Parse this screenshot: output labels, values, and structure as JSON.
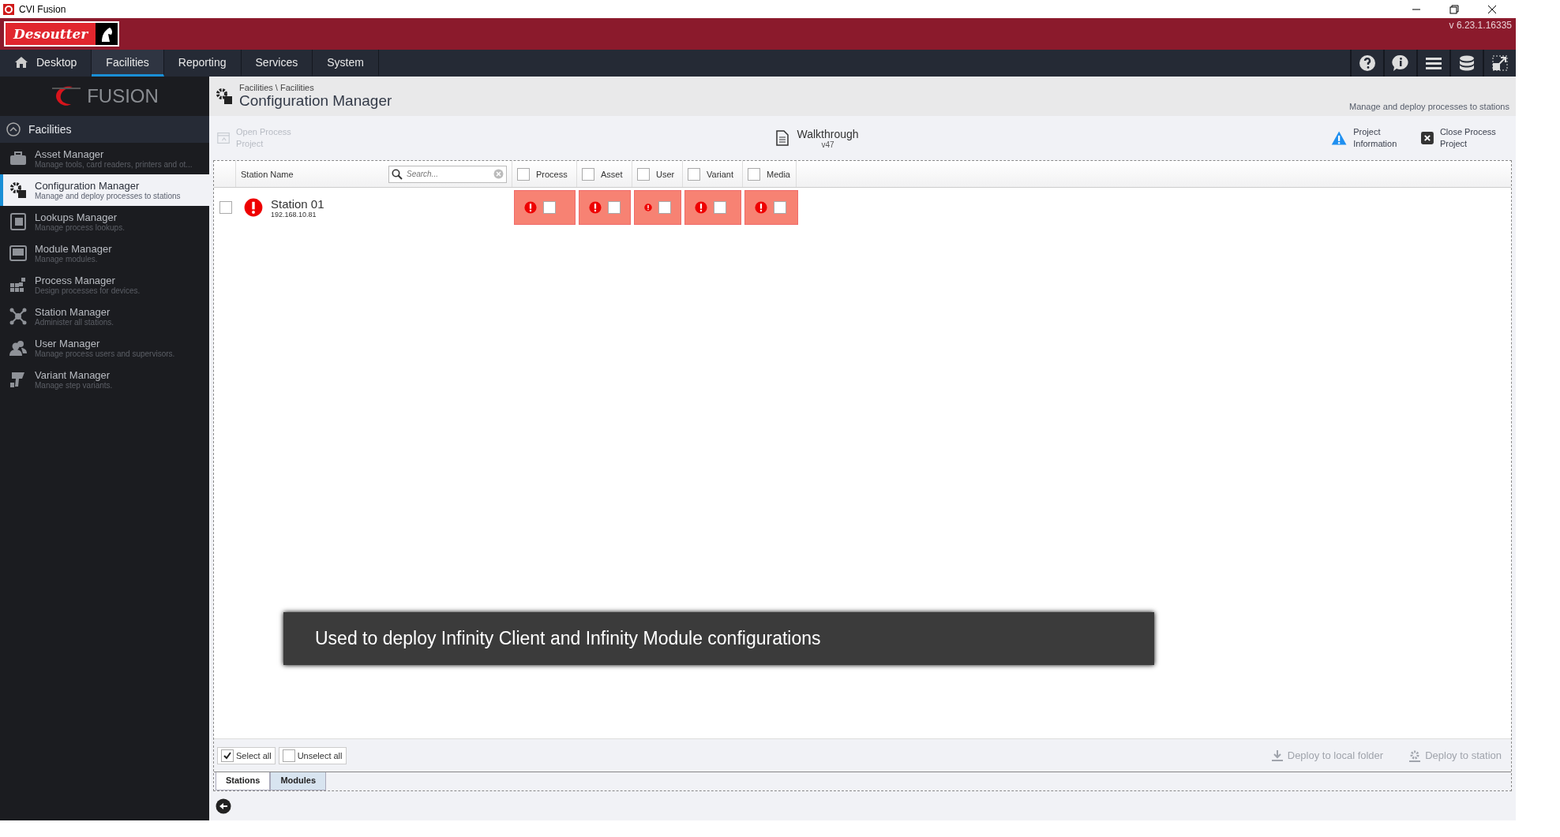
{
  "window": {
    "title": "CVI Fusion"
  },
  "header": {
    "brand": "Desoutter",
    "version": "v 6.23.1.16335"
  },
  "nav": [
    {
      "label": "Desktop",
      "selected": false
    },
    {
      "label": "Facilities",
      "selected": true
    },
    {
      "label": "Reporting",
      "selected": false
    },
    {
      "label": "Services",
      "selected": false
    },
    {
      "label": "System",
      "selected": false
    }
  ],
  "sidebar": {
    "logo": "FUSION",
    "section": {
      "label": "Facilities",
      "expanded": true
    },
    "items": [
      {
        "title": "Asset Manager",
        "subtitle": "Manage tools, card readers, printers and ot...",
        "selected": false
      },
      {
        "title": "Configuration Manager",
        "subtitle": "Manage and deploy processes to stations",
        "selected": true
      },
      {
        "title": "Lookups Manager",
        "subtitle": "Manage process lookups.",
        "selected": false
      },
      {
        "title": "Module Manager",
        "subtitle": "Manage modules.",
        "selected": false
      },
      {
        "title": "Process Manager",
        "subtitle": "Design processes for devices.",
        "selected": false
      },
      {
        "title": "Station Manager",
        "subtitle": "Administer all stations.",
        "selected": false
      },
      {
        "title": "User Manager",
        "subtitle": "Manage process users and supervisors.",
        "selected": false
      },
      {
        "title": "Variant Manager",
        "subtitle": "Manage step variants.",
        "selected": false
      }
    ]
  },
  "page": {
    "breadcrumb": "Facilities \\ Facilities",
    "title": "Configuration Manager",
    "description": "Manage and deploy processes to stations"
  },
  "toolbar": {
    "open": {
      "label": "Open Process Project",
      "disabled": true
    },
    "project": {
      "name": "Walkthrough",
      "version": "v47"
    },
    "actions": [
      {
        "kind": "info",
        "label": "Project Information"
      },
      {
        "kind": "close",
        "label": "Close Process Project"
      }
    ]
  },
  "table": {
    "name_column": "Station Name",
    "search": {
      "placeholder": "Search..."
    },
    "columns": [
      {
        "label": "Process",
        "checked": false
      },
      {
        "label": "Asset",
        "checked": false
      },
      {
        "label": "User",
        "checked": false
      },
      {
        "label": "Variant",
        "checked": false
      },
      {
        "label": "Media",
        "checked": false
      }
    ],
    "rows": [
      {
        "name": "Station 01",
        "address": "192.168.10.81",
        "checked": false,
        "cells": [
          {
            "checked": false
          },
          {
            "checked": false
          },
          {
            "checked": false
          },
          {
            "checked": false
          },
          {
            "checked": false
          }
        ]
      }
    ]
  },
  "tooltip": "Used to deploy Infinity Client and Infinity Module configurations",
  "footer": {
    "select": [
      {
        "label": "Select all",
        "checked": true
      },
      {
        "label": "Unselect all",
        "checked": false
      }
    ],
    "deploy": [
      {
        "label": "Deploy to local folder",
        "disabled": true
      },
      {
        "label": "Deploy to station",
        "disabled": true
      }
    ],
    "tabs": [
      {
        "label": "Stations",
        "selected": true
      },
      {
        "label": "Modules",
        "selected": false
      }
    ]
  }
}
